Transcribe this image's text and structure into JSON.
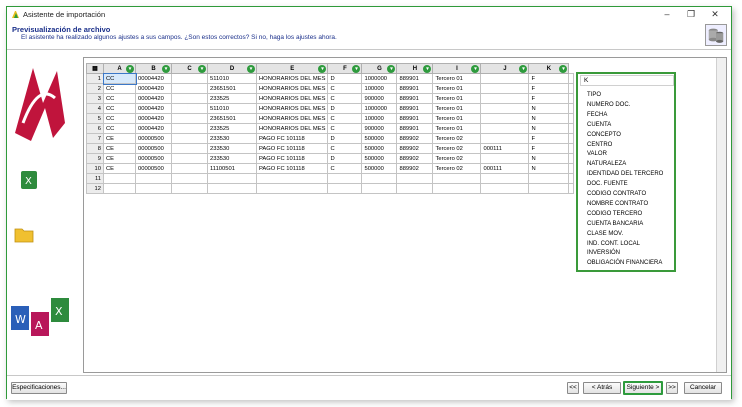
{
  "window": {
    "title": "Asistente de importación",
    "minimize_icon": "–",
    "maximize_icon": "❐",
    "close_icon": "✕"
  },
  "header": {
    "title": "Previsualización de archivo",
    "subtitle": "El asistente ha realizado algunos ajustes a sus campos. ¿Son estos correctos? Si no, haga los ajustes ahora."
  },
  "grid": {
    "corner": "▦",
    "arrow_icon": "▾",
    "columns": [
      "A",
      "B",
      "C",
      "D",
      "E",
      "F",
      "G",
      "H",
      "I",
      "J",
      "K"
    ],
    "row_numbers": [
      "1",
      "2",
      "3",
      "4",
      "5",
      "6",
      "7",
      "8",
      "9",
      "10",
      "11",
      "12"
    ],
    "rows": [
      [
        "CC",
        "00004420",
        "",
        "511010",
        "HONORARIOS DEL MES",
        "D",
        "1000000",
        "889901",
        "Tercero 01",
        "",
        "F"
      ],
      [
        "CC",
        "00004420",
        "",
        "23651501",
        "HONORARIOS DEL MES",
        "C",
        "100000",
        "889901",
        "Tercero 01",
        "",
        "F"
      ],
      [
        "CC",
        "00004420",
        "",
        "233525",
        "HONORARIOS DEL MES",
        "C",
        "900000",
        "889901",
        "Tercero 01",
        "",
        "F"
      ],
      [
        "CC",
        "00004420",
        "",
        "511010",
        "HONORARIOS DEL MES",
        "D",
        "1000000",
        "889901",
        "Tercero 01",
        "",
        "N"
      ],
      [
        "CC",
        "00004420",
        "",
        "23651501",
        "HONORARIOS DEL MES",
        "C",
        "100000",
        "889901",
        "Tercero 01",
        "",
        "N"
      ],
      [
        "CC",
        "00004420",
        "",
        "233525",
        "HONORARIOS DEL MES",
        "C",
        "900000",
        "889901",
        "Tercero 01",
        "",
        "N"
      ],
      [
        "CE",
        "00000500",
        "",
        "233530",
        "PAGO FC 101118",
        "D",
        "500000",
        "889902",
        "Tercero 02",
        "",
        "F"
      ],
      [
        "CE",
        "00000500",
        "",
        "233530",
        "PAGO FC 101118",
        "C",
        "500000",
        "889902",
        "Tercero 02",
        "000111",
        "F"
      ],
      [
        "CE",
        "00000500",
        "",
        "233530",
        "PAGO FC 101118",
        "D",
        "500000",
        "889902",
        "Tercero 02",
        "",
        "N"
      ],
      [
        "CE",
        "00000500",
        "",
        "11100501",
        "PAGO FC 101118",
        "C",
        "500000",
        "889902",
        "Tercero 02",
        "000111",
        "N"
      ],
      [
        "",
        "",
        "",
        "",
        "",
        "",
        "",
        "",
        "",
        "",
        ""
      ],
      [
        "",
        "",
        "",
        "",
        "",
        "",
        "",
        "",
        "",
        "",
        ""
      ]
    ]
  },
  "dropdown": {
    "selected": "K",
    "options": [
      "TIPO",
      "NUMERO DOC.",
      "FECHA",
      "CUENTA",
      "CONCEPTO",
      "CENTRO",
      "VALOR",
      "NATURALEZA",
      "IDENTIDAD DEL TERCERO",
      "DOC. FUENTE",
      "CODIGO CONTRATO",
      "NOMBRE CONTRATO",
      "CODIGO TERCERO",
      "CUENTA BANCARIA",
      "CLASE MOV.",
      "IND. CONT. LOCAL",
      "INVERSIÓN",
      "OBLIGACIÓN FINANCIERA"
    ]
  },
  "footer": {
    "specs_label": "Especificaciones...",
    "first_label": "<<",
    "back_label": "< Atrás",
    "next_label": "Siguiente >",
    "last_label": ">>",
    "cancel_label": "Cancelar"
  }
}
